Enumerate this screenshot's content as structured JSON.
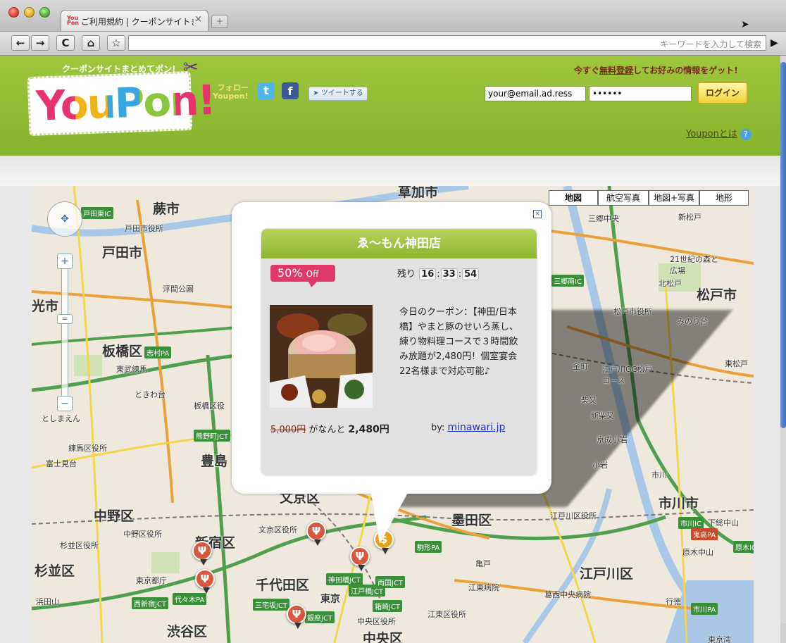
{
  "browser": {
    "tab_title": "ご利用規約 | クーポンサイトまとめて",
    "tab_favicon": "You Pon",
    "close_glyph": "×",
    "newtab_glyph": "+",
    "back_glyph": "←",
    "forward_glyph": "→",
    "reload_glyph": "C",
    "home_glyph": "⌂",
    "bookmark_glyph": "☆",
    "go_glyph": "▶",
    "url_value": "",
    "search_placeholder": "キーワードを入力して検索"
  },
  "header": {
    "catchphrase": "クーポンサイトまとめてポン!",
    "logo_text": "YouPon!",
    "follow_line1": "フォロー",
    "follow_line2": "Youpon!",
    "twitter_glyph": "t",
    "facebook_glyph": "f",
    "tweet_button": "ツイートする",
    "signup_prefix": "今すぐ",
    "signup_link": "無料登録",
    "signup_suffix": "してお好みの情報をゲット!",
    "email_value": "your@email.ad.ress",
    "password_value": "••••••",
    "login_button": "ログイン",
    "about_link": "Youponとは",
    "about_icon": "?"
  },
  "map": {
    "types": [
      "地図",
      "航空写真",
      "地図+写真",
      "地形"
    ],
    "zoom_in": "+",
    "zoom_out": "−",
    "zoom_thumb": "=",
    "pan_glyph": "✥",
    "labels": [
      {
        "t": "蕨市",
        "c": "big"
      },
      {
        "t": "戸田市",
        "c": "big"
      },
      {
        "t": "戸田市役所",
        "c": "sm"
      },
      {
        "t": "浮間公園",
        "c": "sm"
      },
      {
        "t": "光市",
        "c": "big"
      },
      {
        "t": "板橋区",
        "c": "big"
      },
      {
        "t": "東武練馬",
        "c": "sm"
      },
      {
        "t": "ときわ台",
        "c": "sm"
      },
      {
        "t": "板橋区役",
        "c": "sm"
      },
      {
        "t": "としまえん",
        "c": "sm"
      },
      {
        "t": "練馬区役所",
        "c": "sm"
      },
      {
        "t": "富士見台",
        "c": "sm"
      },
      {
        "t": "豊島",
        "c": "big"
      },
      {
        "t": "中野区",
        "c": "big"
      },
      {
        "t": "中野区役所",
        "c": "sm"
      },
      {
        "t": "新宿区",
        "c": "big"
      },
      {
        "t": "杉並区役所",
        "c": "sm"
      },
      {
        "t": "杉並区",
        "c": "big"
      },
      {
        "t": "東京都庁",
        "c": "sm"
      },
      {
        "t": "浜田山",
        "c": "sm"
      },
      {
        "t": "渋谷区",
        "c": "big"
      },
      {
        "t": "千代田区",
        "c": "big"
      },
      {
        "t": "中央区役所",
        "c": "sm"
      },
      {
        "t": "中央区",
        "c": "big"
      },
      {
        "t": "文京区役所",
        "c": "sm"
      },
      {
        "t": "墨田区",
        "c": "big"
      },
      {
        "t": "江東区役所",
        "c": "sm"
      },
      {
        "t": "江東病院",
        "c": "sm"
      },
      {
        "t": "亀戸",
        "c": "sm"
      },
      {
        "t": "江戸川区",
        "c": "big"
      },
      {
        "t": "江戸川区役所",
        "c": "sm"
      },
      {
        "t": "葛西中央病院",
        "c": "sm"
      },
      {
        "t": "行徳",
        "c": "sm"
      },
      {
        "t": "市川市",
        "c": "big"
      },
      {
        "t": "下総中山",
        "c": "sm"
      },
      {
        "t": "原木中山",
        "c": "sm"
      },
      {
        "t": "東京湾",
        "c": "sm"
      },
      {
        "t": "松戸市",
        "c": "big"
      },
      {
        "t": "三郷中央",
        "c": "sm"
      },
      {
        "t": "新松戸",
        "c": "sm"
      },
      {
        "t": "21世紀の森と広場",
        "c": "sm"
      },
      {
        "t": "北松戸",
        "c": "sm"
      },
      {
        "t": "松戸市役所",
        "c": "sm"
      },
      {
        "t": "みのり台",
        "c": "sm"
      },
      {
        "t": "江戸川GC松戸コース",
        "c": "sm"
      },
      {
        "t": "東松戸",
        "c": "sm"
      },
      {
        "t": "京成小岩",
        "c": "sm"
      },
      {
        "t": "小岩",
        "c": "sm"
      },
      {
        "t": "市川",
        "c": "sm"
      },
      {
        "t": "柴又",
        "c": "sm"
      },
      {
        "t": "新柴又",
        "c": "sm"
      },
      {
        "t": "金町",
        "c": "sm"
      },
      {
        "t": "文京区",
        "c": "big"
      },
      {
        "t": "東京",
        "c": "med"
      },
      {
        "t": "草加市",
        "c": "big"
      }
    ],
    "pin_glyph": "Ψ",
    "pin_gold_glyph": "$"
  },
  "popup": {
    "close_glyph": "×",
    "shop_name": "ゑ〜もん神田店",
    "discount_num": "50%",
    "discount_word": "Off",
    "remaining_label": "残り",
    "timer_h": "16",
    "timer_m": "33",
    "timer_s": "54",
    "timer_sep": ":",
    "description": "今日のクーポン：【神田/日本橋】やまと豚のせいろ蒸し、練り物料理コースで３時間飲み放題が2,480円！個室宴会22名様まで対応可能♪",
    "original_price": "5,000円",
    "price_mid": "がなんと",
    "sale_price": "2,480円",
    "by_label": "by:",
    "source_link": "minawari.jp"
  },
  "colors": {
    "brand_green": "#9ec73e",
    "pink": "#e0386a",
    "pin_orange": "#d9573a",
    "highway_green": "#3a8f3a"
  }
}
